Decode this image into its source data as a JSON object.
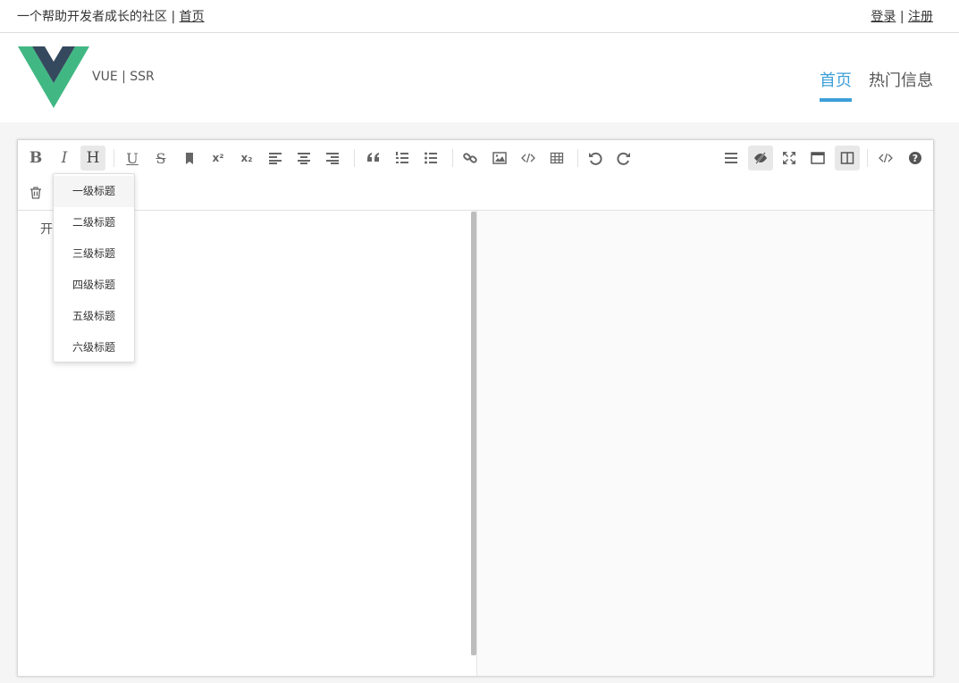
{
  "topbar": {
    "tagline": "一个帮助开发者成长的社区",
    "separator": "|",
    "home_link": "首页",
    "login": "登录",
    "register": "注册"
  },
  "header": {
    "brand": "VUE | SSR",
    "nav": [
      {
        "label": "首页",
        "active": true
      },
      {
        "label": "热门信息",
        "active": false
      }
    ],
    "accent_color": "#3d9fd8"
  },
  "toolbar": {
    "icons": [
      "bold-icon",
      "italic-icon",
      "heading-icon",
      "underline-icon",
      "strikethrough-icon",
      "mark-icon",
      "superscript-icon",
      "subscript-icon",
      "align-left-icon",
      "align-center-icon",
      "align-right-icon",
      "quote-icon",
      "ordered-list-icon",
      "unordered-list-icon",
      "link-icon",
      "image-icon",
      "code-icon",
      "table-icon",
      "undo-icon",
      "redo-icon",
      "navigation-icon",
      "preview-toggle-icon",
      "fullscreen-icon",
      "read-mode-icon",
      "subfield-icon",
      "html-code-icon",
      "help-icon",
      "trash-icon"
    ],
    "bold_glyph": "B",
    "italic_glyph": "I",
    "heading_glyph": "H",
    "underline_glyph": "U",
    "strike_glyph": "S",
    "sup_glyph": "x²",
    "sub_glyph": "x₂"
  },
  "editor": {
    "content": "开"
  },
  "heading_menu": {
    "items": [
      "一级标题",
      "二级标题",
      "三级标题",
      "四级标题",
      "五级标题",
      "六级标题"
    ]
  }
}
